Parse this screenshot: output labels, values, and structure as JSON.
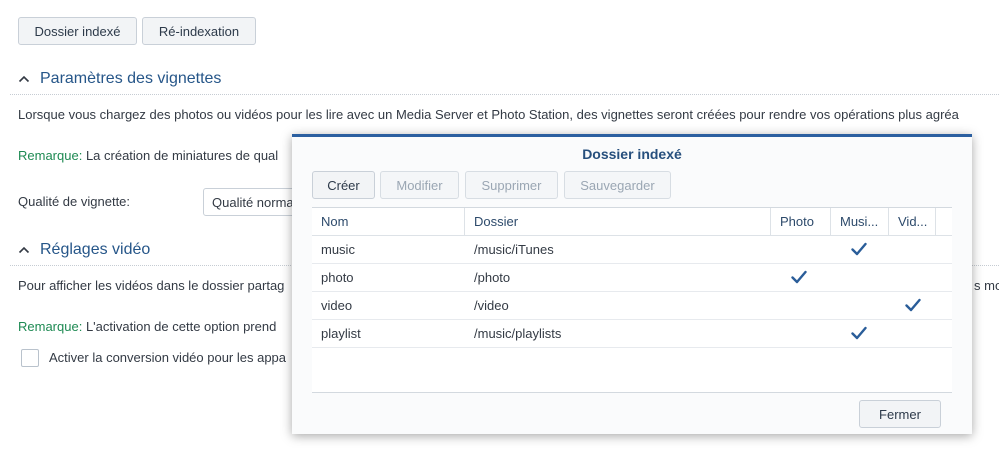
{
  "toolbar": {
    "indexed_folder_label": "Dossier indexé",
    "reindex_label": "Ré-indexation"
  },
  "thumbnails": {
    "title": "Paramètres des vignettes",
    "description": "Lorsque vous chargez des photos ou vidéos pour les lire avec un Media Server et Photo Station, des vignettes seront créées pour rendre vos opérations plus agréa",
    "remark_label": "Remarque:",
    "remark_text": "La création de miniatures de qual",
    "quality_label": "Qualité de vignette:",
    "quality_value": "Qualité norma"
  },
  "video": {
    "title": "Réglages vidéo",
    "description": "Pour afficher les vidéos dans le dossier partag",
    "description_tail": "s mol",
    "remark_label": "Remarque:",
    "remark_text": "L'activation de cette option prend",
    "checkbox_label": "Activer la conversion vidéo pour les appa"
  },
  "dialog": {
    "title": "Dossier indexé",
    "buttons": {
      "create": "Créer",
      "edit": "Modifier",
      "delete": "Supprimer",
      "save": "Sauvegarder"
    },
    "columns": [
      "Nom",
      "Dossier",
      "Photo",
      "Musi...",
      "Vid..."
    ],
    "rows": [
      {
        "name": "music",
        "folder": "/music/iTunes",
        "photo": false,
        "music": true,
        "video": false
      },
      {
        "name": "photo",
        "folder": "/photo",
        "photo": true,
        "music": false,
        "video": false
      },
      {
        "name": "video",
        "folder": "/video",
        "photo": false,
        "music": false,
        "video": true
      },
      {
        "name": "playlist",
        "folder": "/music/playlists",
        "photo": false,
        "music": true,
        "video": false
      }
    ],
    "close_label": "Fermer"
  },
  "colors": {
    "accent": "#265689",
    "remark": "#1e8a53",
    "check": "#2a5d99"
  }
}
